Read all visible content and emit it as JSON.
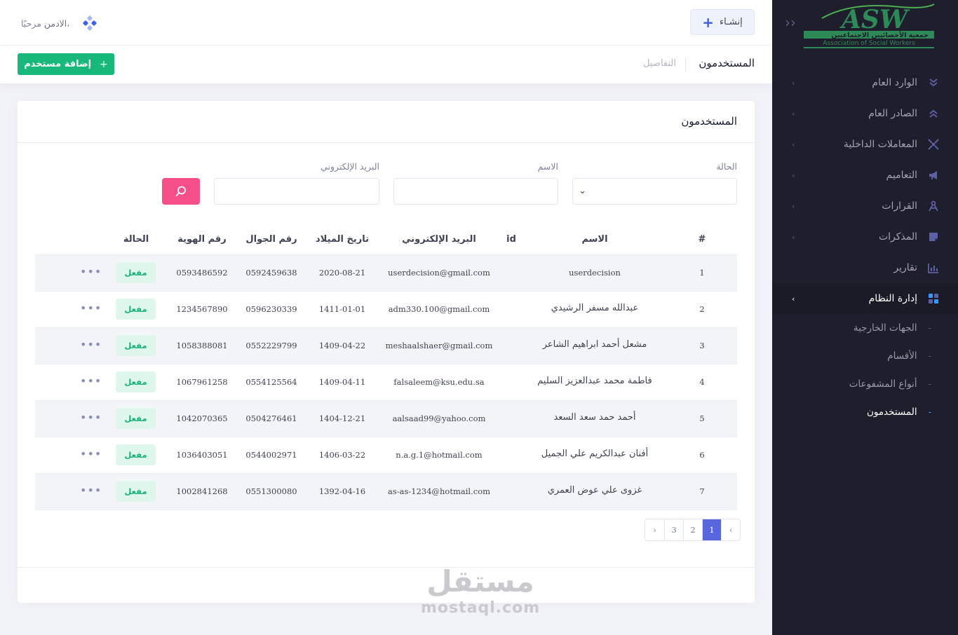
{
  "header": {
    "create_label": "إنشـاء",
    "greeting": "مرحبًا،",
    "username": "الادمن"
  },
  "sidebar": {
    "logo_text": "ASW",
    "logo_subtitle_ar": "جمعية الأخصائيين الاجتماعيين",
    "logo_subtitle_en": "Association of Social Workers",
    "items": [
      {
        "label": "الوارد العام",
        "icon": "double-chevron-down-icon"
      },
      {
        "label": "الصادر العام",
        "icon": "double-chevron-up-icon"
      },
      {
        "label": "المعاملات الداخلية",
        "icon": "arrows-in-icon"
      },
      {
        "label": "التعاميم",
        "icon": "megaphone-icon"
      },
      {
        "label": "القرارات",
        "icon": "compass-icon"
      },
      {
        "label": "المذكرات",
        "icon": "note-icon"
      },
      {
        "label": "تقارير",
        "icon": "bar-chart-icon"
      },
      {
        "label": "إدارة النظام",
        "icon": "grid-icon"
      }
    ],
    "submenu": [
      {
        "label": "الجهات الخارجية"
      },
      {
        "label": "الأقسام"
      },
      {
        "label": "أنواع المشفوعات"
      },
      {
        "label": "المستخدمون"
      }
    ]
  },
  "subheader": {
    "title": "المستخدمون",
    "crumb": "التفاصيل",
    "add_user_label": "إضافة مستخدم"
  },
  "card": {
    "title": "المستخدمون"
  },
  "filters": {
    "status_label": "الحالة",
    "name_label": "الاسم",
    "email_label": "البريد الإلكتروني",
    "status_value": "",
    "name_value": "",
    "email_value": ""
  },
  "table": {
    "headers": {
      "num": "#",
      "name": "الاسم",
      "id": "id",
      "email": "البريد الإلكتروني",
      "birth": "تاريخ الميلاد",
      "mobile": "رقم الجوال",
      "national_id": "رقم الهوية",
      "status": "الحالة"
    },
    "rows": [
      {
        "num": "1",
        "name": "userdecision",
        "id": "",
        "email": "userdecision@gmail.com",
        "birth": "2020-08-21",
        "mobile": "0592459638",
        "national_id": "0593486592",
        "status": "مفعل"
      },
      {
        "num": "2",
        "name": "عبدالله مسفر الرشيدي",
        "id": "",
        "email": "adm330.100@gmail.com",
        "birth": "1411-01-01",
        "mobile": "0596230339",
        "national_id": "1234567890",
        "status": "مفعل"
      },
      {
        "num": "3",
        "name": "مشعل أحمد ابراهيم الشاعر",
        "id": "",
        "email": "meshaalshaer@gmail.com",
        "birth": "1409-04-22",
        "mobile": "0552229799",
        "national_id": "1058388081",
        "status": "مفعل"
      },
      {
        "num": "4",
        "name": "فاطمة محمد عبدالعزيز السليم",
        "id": "",
        "email": "falsaleem@ksu.edu.sa",
        "birth": "1409-04-11",
        "mobile": "0554125564",
        "national_id": "1067961258",
        "status": "مفعل"
      },
      {
        "num": "5",
        "name": "أحمد حمد سعد السعد",
        "id": "",
        "email": "aalsaad99@yahoo.com",
        "birth": "1404-12-21",
        "mobile": "0504276461",
        "national_id": "1042070365",
        "status": "مفعل"
      },
      {
        "num": "6",
        "name": "أفنان عبدالكريم علي الجميل",
        "id": "",
        "email": "n.a.g.1@hotmail.com",
        "birth": "1406-03-22",
        "mobile": "0544002971",
        "national_id": "1036403051",
        "status": "مفعل"
      },
      {
        "num": "7",
        "name": "غزوى علي عوض العمري",
        "id": "",
        "email": "as-as-1234@hotmail.com",
        "birth": "1392-04-16",
        "mobile": "0551300080",
        "national_id": "1002841268",
        "status": "مفعل"
      }
    ],
    "more_label": "•••"
  },
  "pagination": {
    "prev": "‹",
    "pages": [
      "1",
      "2",
      "3"
    ],
    "current": "1",
    "next": "›"
  },
  "watermark": {
    "ar": "مستقل",
    "en": "mostaql.com"
  },
  "colors": {
    "sidebar_bg": "#1e1e2d",
    "accent": "#5867dd",
    "success": "#18b87a",
    "search_btn": "#f64e88"
  }
}
